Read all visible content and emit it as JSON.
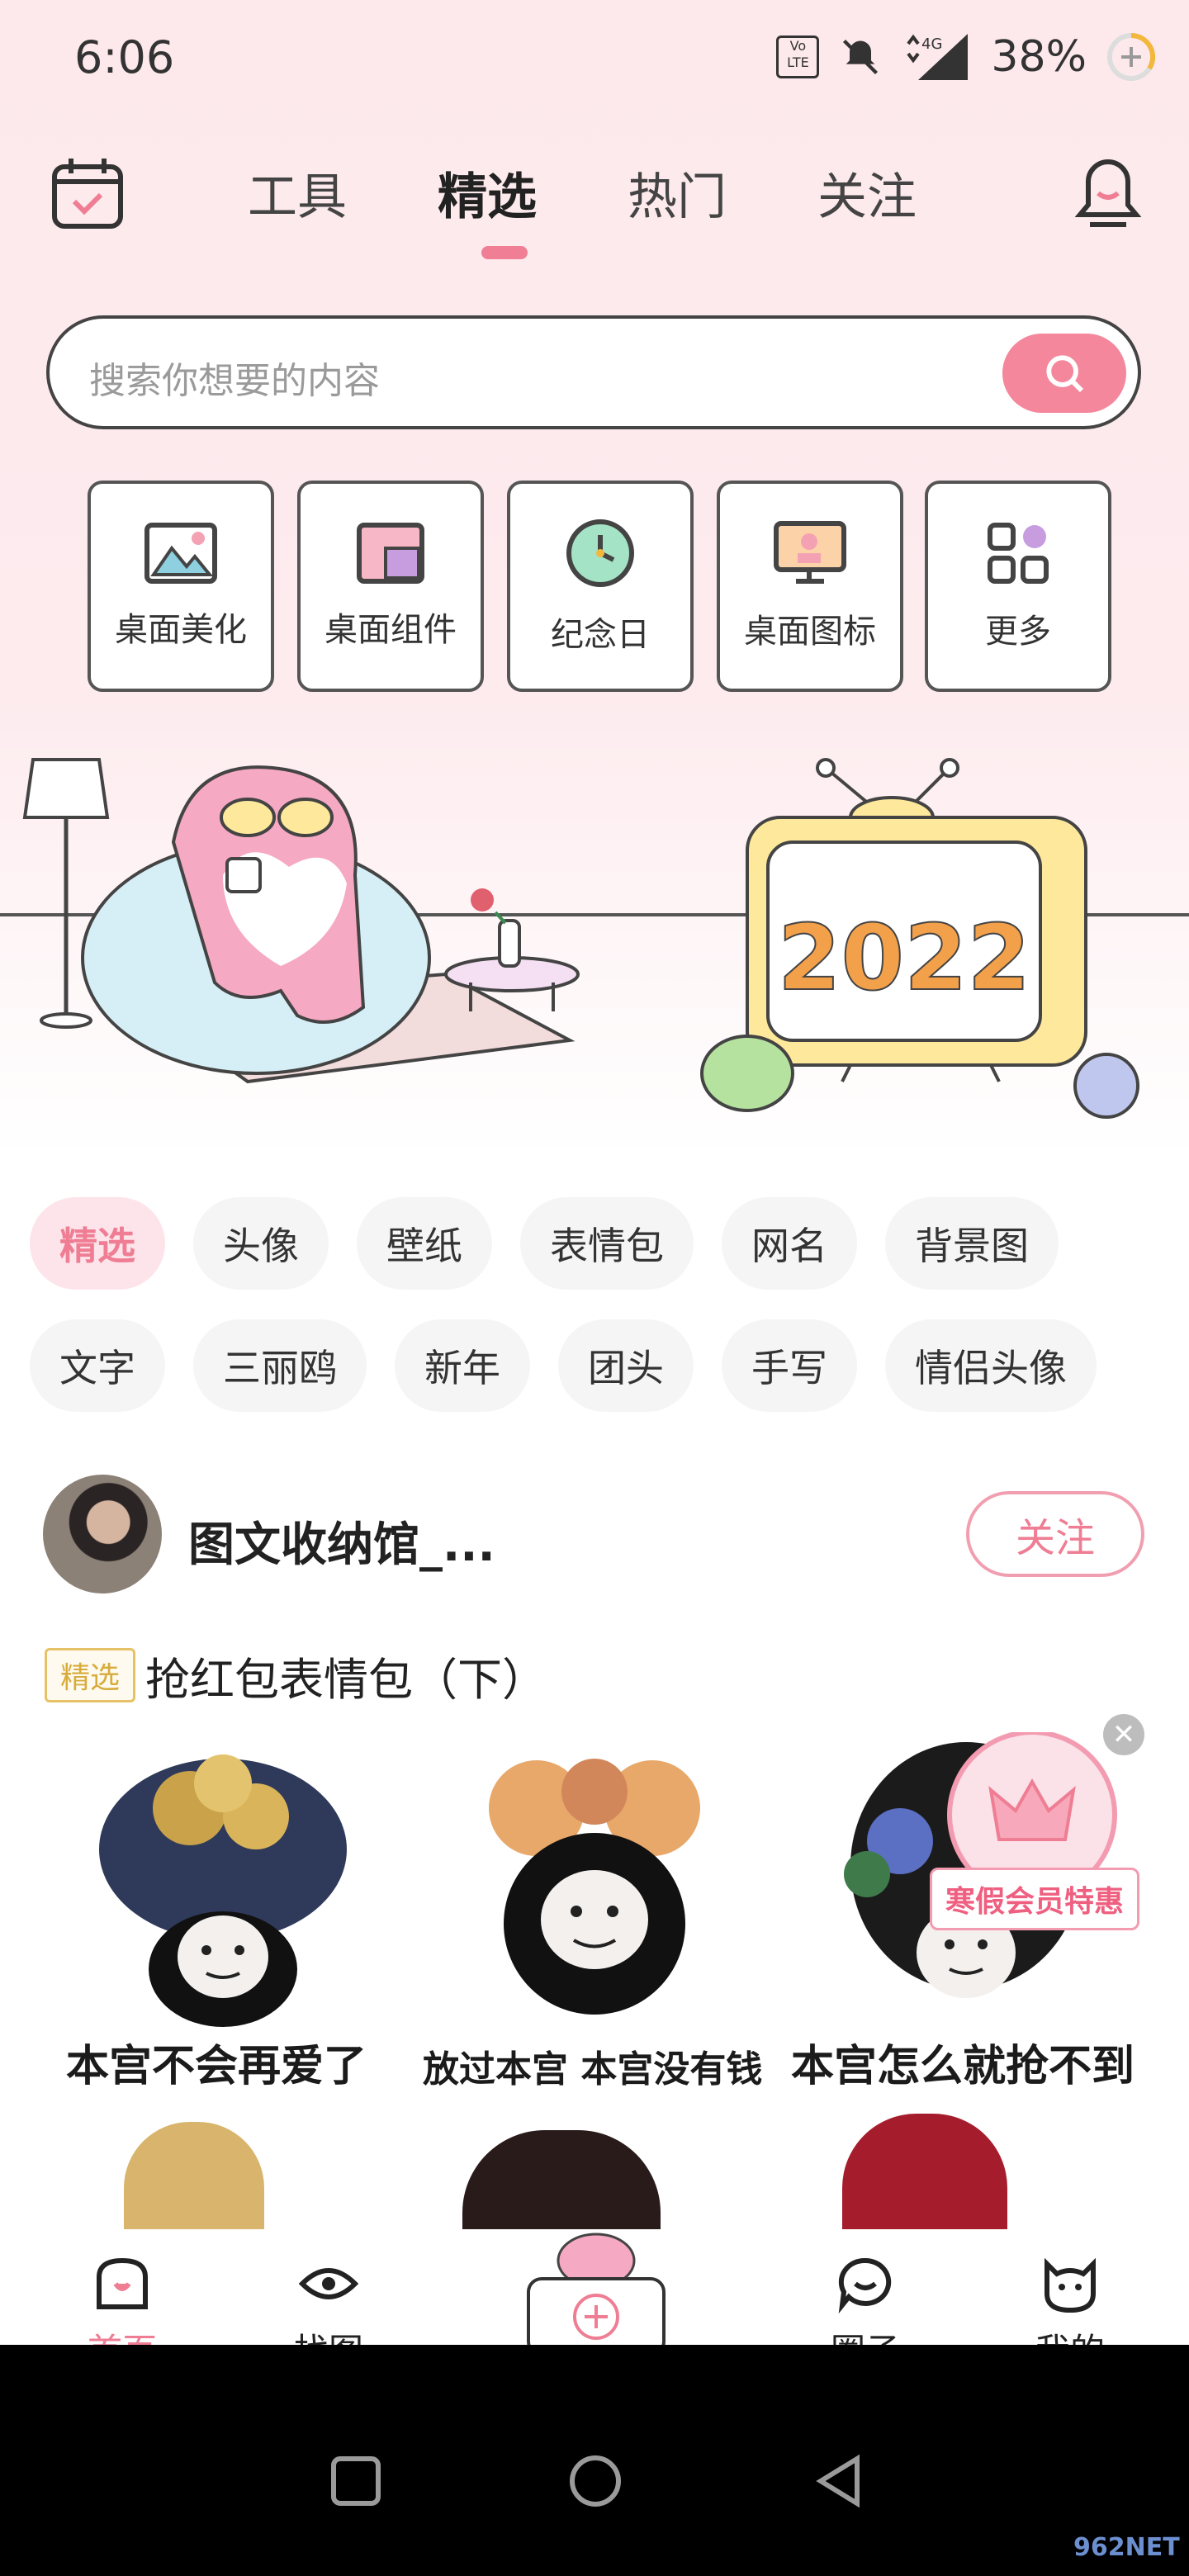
{
  "status_bar": {
    "time": "6:06",
    "battery": "38%",
    "network": "4G"
  },
  "header": {
    "tabs": [
      {
        "label": "工具",
        "active": false
      },
      {
        "label": "精选",
        "active": true
      },
      {
        "label": "热门",
        "active": false
      },
      {
        "label": "关注",
        "active": false
      }
    ]
  },
  "search": {
    "placeholder": "搜索你想要的内容"
  },
  "quick_actions": [
    {
      "label": "桌面美化",
      "icon": "picture-icon"
    },
    {
      "label": "桌面组件",
      "icon": "widget-icon"
    },
    {
      "label": "纪念日",
      "icon": "clock-icon"
    },
    {
      "label": "桌面图标",
      "icon": "monitor-icon"
    },
    {
      "label": "更多",
      "icon": "grid-icon"
    }
  ],
  "banner": {
    "year_text": "2022"
  },
  "categories": {
    "row1": [
      "精选",
      "头像",
      "壁纸",
      "表情包",
      "网名",
      "背景图"
    ],
    "row2": [
      "文字",
      "三丽鸥",
      "新年",
      "团头",
      "手写",
      "情侣头像"
    ],
    "active": "精选"
  },
  "post": {
    "author": "图文收纳馆_...",
    "follow_label": "关注",
    "badge": "精选",
    "title": "抢红包表情包（下）",
    "captions": [
      "本宫不会再爱了",
      "放过本宫 本宫没有钱",
      "本宫怎么就抢不到"
    ],
    "promo": "寒假会员特惠"
  },
  "bottom_nav": [
    {
      "label": "首页",
      "active": true
    },
    {
      "label": "找图",
      "active": false
    },
    {
      "label": "",
      "active": false
    },
    {
      "label": "圈子",
      "active": false
    },
    {
      "label": "我的",
      "active": false
    }
  ],
  "colors": {
    "accent": "#ef7d93",
    "background_top": "#fde9ec"
  },
  "watermark": "962NET"
}
